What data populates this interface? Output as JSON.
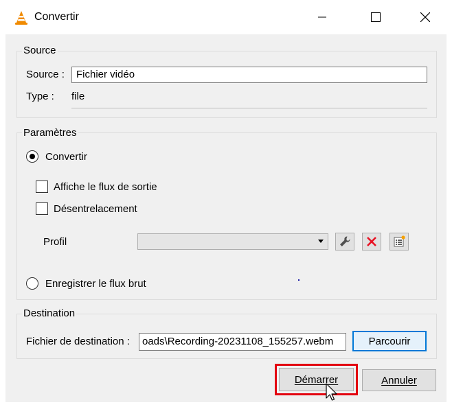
{
  "window": {
    "title": "Convertir",
    "icon": "vlc-cone-icon"
  },
  "source_group": {
    "title": "Source",
    "source_label": "Source :",
    "source_value": "Fichier vidéo",
    "type_label": "Type :",
    "type_value": "file"
  },
  "settings_group": {
    "title": "Paramètres",
    "convert_label": "Convertir",
    "convert_selected": true,
    "show_output_label": "Affiche le flux de sortie",
    "show_output_checked": false,
    "deinterlace_label": "Désentrelacement",
    "deinterlace_checked": false,
    "profile_label": "Profil",
    "profile_value": "",
    "dump_raw_label": "Enregistrer le flux brut",
    "dump_raw_selected": false
  },
  "destination_group": {
    "title": "Destination",
    "file_label": "Fichier de destination :",
    "file_value": "oads\\Recording-20231108_155257.webm",
    "browse_label": "Parcourir"
  },
  "actions": {
    "start_label": "Démarrer",
    "cancel_label": "Annuler"
  },
  "colors": {
    "highlight": "#e3000f",
    "focus": "#0078d7",
    "delete_red": "#e81123"
  }
}
